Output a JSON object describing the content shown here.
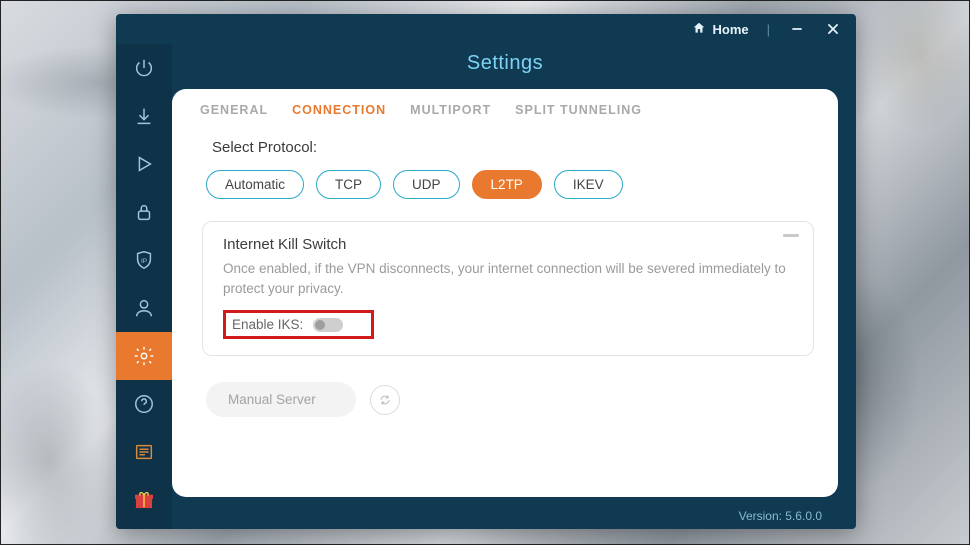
{
  "titlebar": {
    "home_label": "Home"
  },
  "header": {
    "title": "Settings"
  },
  "tabs": [
    {
      "id": "general",
      "label": "GENERAL",
      "active": false
    },
    {
      "id": "connection",
      "label": "CONNECTION",
      "active": true
    },
    {
      "id": "multiport",
      "label": "MULTIPORT",
      "active": false
    },
    {
      "id": "split",
      "label": "SPLIT TUNNELING",
      "active": false
    }
  ],
  "protocol": {
    "section_label": "Select Protocol:",
    "options": [
      {
        "id": "auto",
        "label": "Automatic",
        "active": false
      },
      {
        "id": "tcp",
        "label": "TCP",
        "active": false
      },
      {
        "id": "udp",
        "label": "UDP",
        "active": false
      },
      {
        "id": "l2tp",
        "label": "L2TP",
        "active": true
      },
      {
        "id": "ikev",
        "label": "IKEV",
        "active": false
      }
    ]
  },
  "kill_switch": {
    "title": "Internet Kill Switch",
    "description": "Once enabled, if the VPN disconnects, your internet connection will be severed immediately to protect your privacy.",
    "enable_label": "Enable IKS:",
    "enabled": false
  },
  "manual_server": {
    "label": "Manual Server"
  },
  "version_label": "Version: 5.6.0.0",
  "sidebar": {
    "items": [
      {
        "id": "power",
        "icon": "power-icon"
      },
      {
        "id": "download",
        "icon": "download-icon"
      },
      {
        "id": "play",
        "icon": "play-icon"
      },
      {
        "id": "lock",
        "icon": "lock-icon"
      },
      {
        "id": "ip",
        "icon": "ip-shield-icon"
      },
      {
        "id": "user",
        "icon": "user-icon"
      },
      {
        "id": "settings",
        "icon": "gear-icon",
        "active": true
      },
      {
        "id": "help",
        "icon": "help-icon"
      },
      {
        "id": "news",
        "icon": "news-icon"
      },
      {
        "id": "gift",
        "icon": "gift-icon"
      }
    ]
  }
}
